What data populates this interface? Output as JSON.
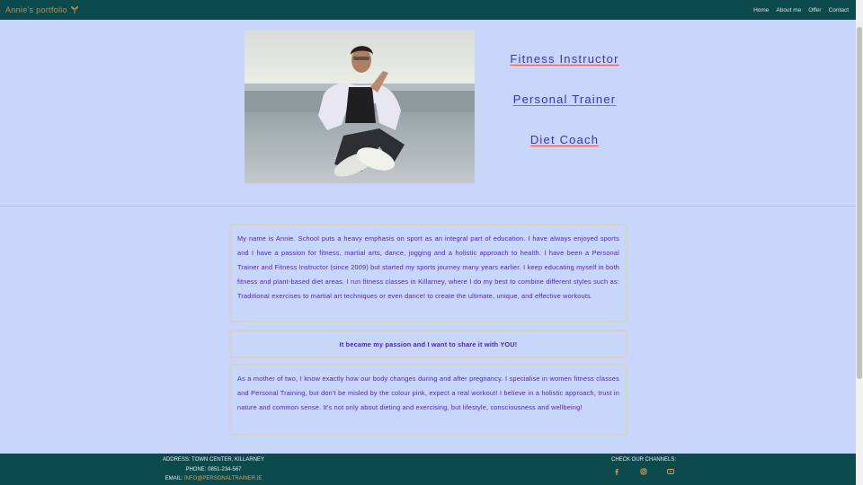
{
  "nav": {
    "brand": "Annie's portfolio",
    "links": [
      "Home",
      "About me",
      "Offer",
      "Contact"
    ]
  },
  "hero": {
    "links": [
      "Fitness Instructor",
      "Personal Trainer",
      "Diet Coach"
    ]
  },
  "about": {
    "paragraph1": "My name is Annie. School puts a heavy emphasis on sport as an integral part of education. I have always enjoyed sports and I have a passion for fitness, martial arts, dance, jogging and a holistic approach to health. I have been a Personal Trainer and Fitness Instructor (since 2009) but started my sports journey many years earlier. I keep educating myself in both fitness and plant-based diet areas. I run fitness classes in Killarney, where I do my best to combine different styles such as: Traditional exercises to martial art techniques or even dance! to create the ultimate, unique, and effective workouts.",
    "highlight": "It became my passion and I want to share it with YOU!",
    "paragraph2": "As a mother of two, I know exactly how our body changes during and after pregnancy. I specialise in women fitness classes and Personal Training, but don't be misled by the colour pink, expect a real workout! I believe in a holistic approach, trust in nature and common sense. It's not only about dieting and exercising, but lifestyle, consciousness and wellbeing!"
  },
  "footer": {
    "address": "ADDRESS: TOWN CENTER, KILLARNEY",
    "phone": "PHONE: 0851-234-567",
    "email_label": "EMAIL: ",
    "email_value": "INFO@PERSONALTRAINER.IE",
    "channels_title": "CHECK OUR CHANNELS:",
    "channel_icons": [
      "facebook-icon",
      "instagram-icon",
      "youtube-icon"
    ]
  },
  "colors": {
    "navbar": "#0d4a4d",
    "background": "#c9d6fb",
    "brand": "#c98a42",
    "link": "#3a2fcf",
    "underline": "#e0564f",
    "card_text": "#4c1fc8"
  }
}
